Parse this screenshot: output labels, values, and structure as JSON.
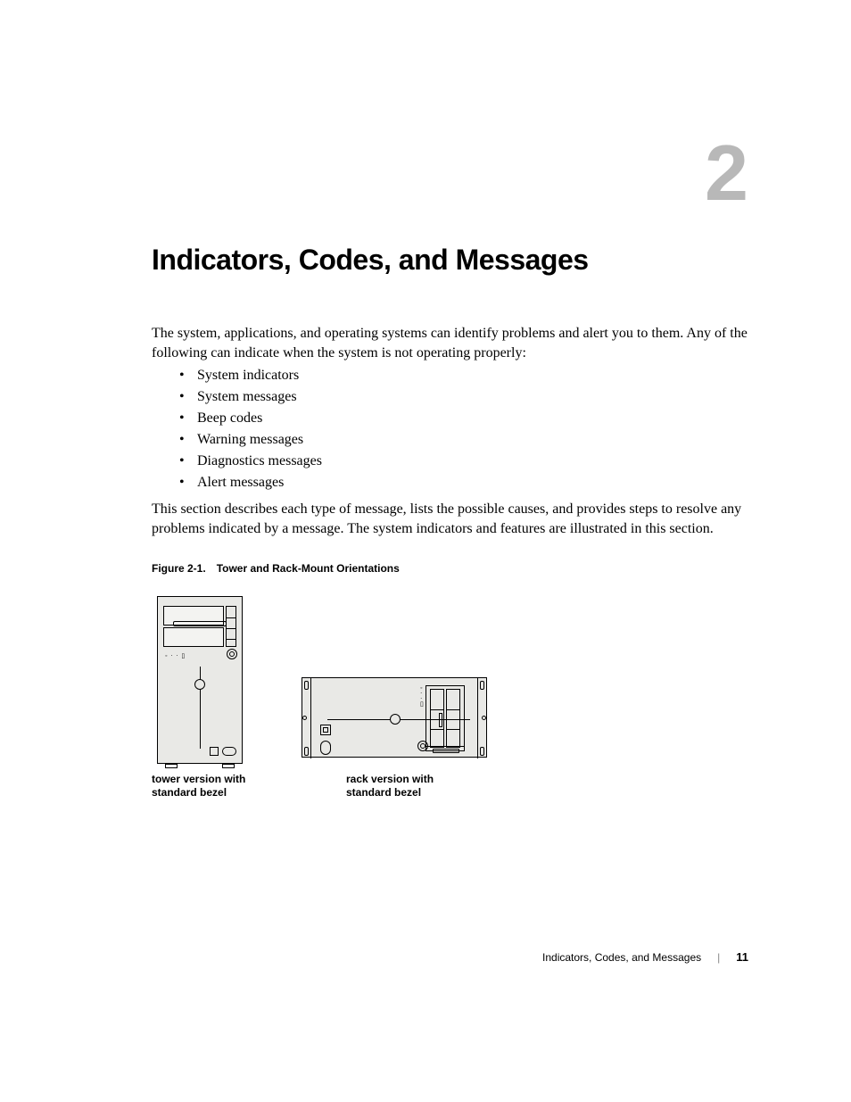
{
  "chapter": {
    "number": "2",
    "title": "Indicators, Codes, and Messages"
  },
  "intro": {
    "p1": "The system, applications, and operating systems can identify problems and alert you to them. Any of the following can indicate when the system is not operating properly:",
    "bullets": [
      "System indicators",
      "System messages",
      "Beep codes",
      "Warning messages",
      "Diagnostics messages",
      "Alert messages"
    ],
    "p2": "This section describes each type of message, lists the possible causes, and provides steps to resolve any problems indicated by a message. The system indicators and features are illustrated in this section."
  },
  "figure": {
    "number": "Figure 2-1.",
    "title": "Tower and Rack-Mount Orientations",
    "tower_label": "tower version with standard bezel",
    "rack_label": "rack version with standard bezel"
  },
  "footer": {
    "section": "Indicators, Codes, and Messages",
    "page": "11"
  }
}
